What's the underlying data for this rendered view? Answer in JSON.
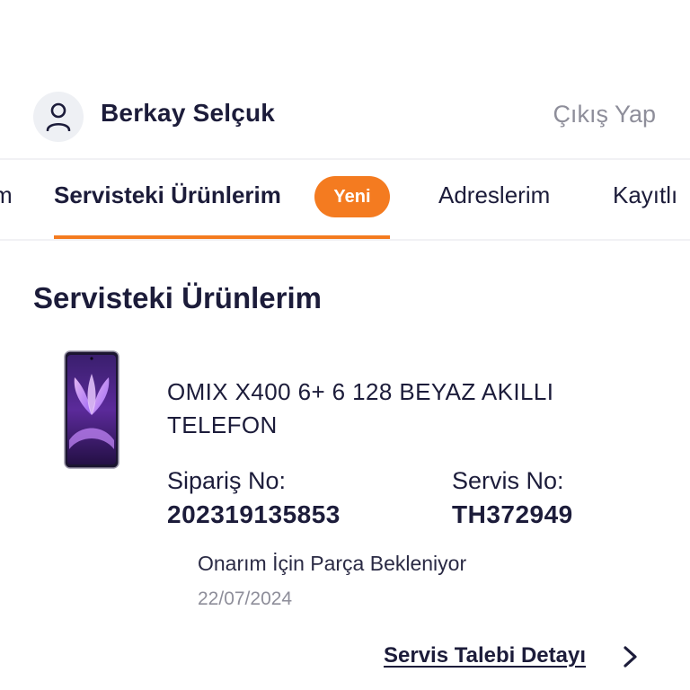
{
  "user": {
    "name": "Berkay Selçuk",
    "logout_label": "Çıkış Yap",
    "avatar_icon": "user-icon"
  },
  "tabs": [
    {
      "label": "m"
    },
    {
      "label": "Servisteki Ürünlerim",
      "badge": "Yeni",
      "active": true
    },
    {
      "label": "Adreslerim"
    },
    {
      "label": "Kayıtlı"
    }
  ],
  "section": {
    "title": "Servisteki Ürünlerim"
  },
  "product": {
    "name": "OMIX X400 6+ 6 128 BEYAZ AKILLI TELEFON",
    "order_label": "Sipariş No:",
    "order_no": "202319135853",
    "service_label": "Servis No:",
    "service_no": "TH372949",
    "status": "Onarım İçin Parça Bekleniyor",
    "date": "22/07/2024",
    "detail_link": "Servis Talebi Detayı",
    "detail_icon": "chevron-right-icon"
  },
  "colors": {
    "accent": "#f47b20",
    "text": "#1c1c3a",
    "muted": "#8e8e9a"
  }
}
